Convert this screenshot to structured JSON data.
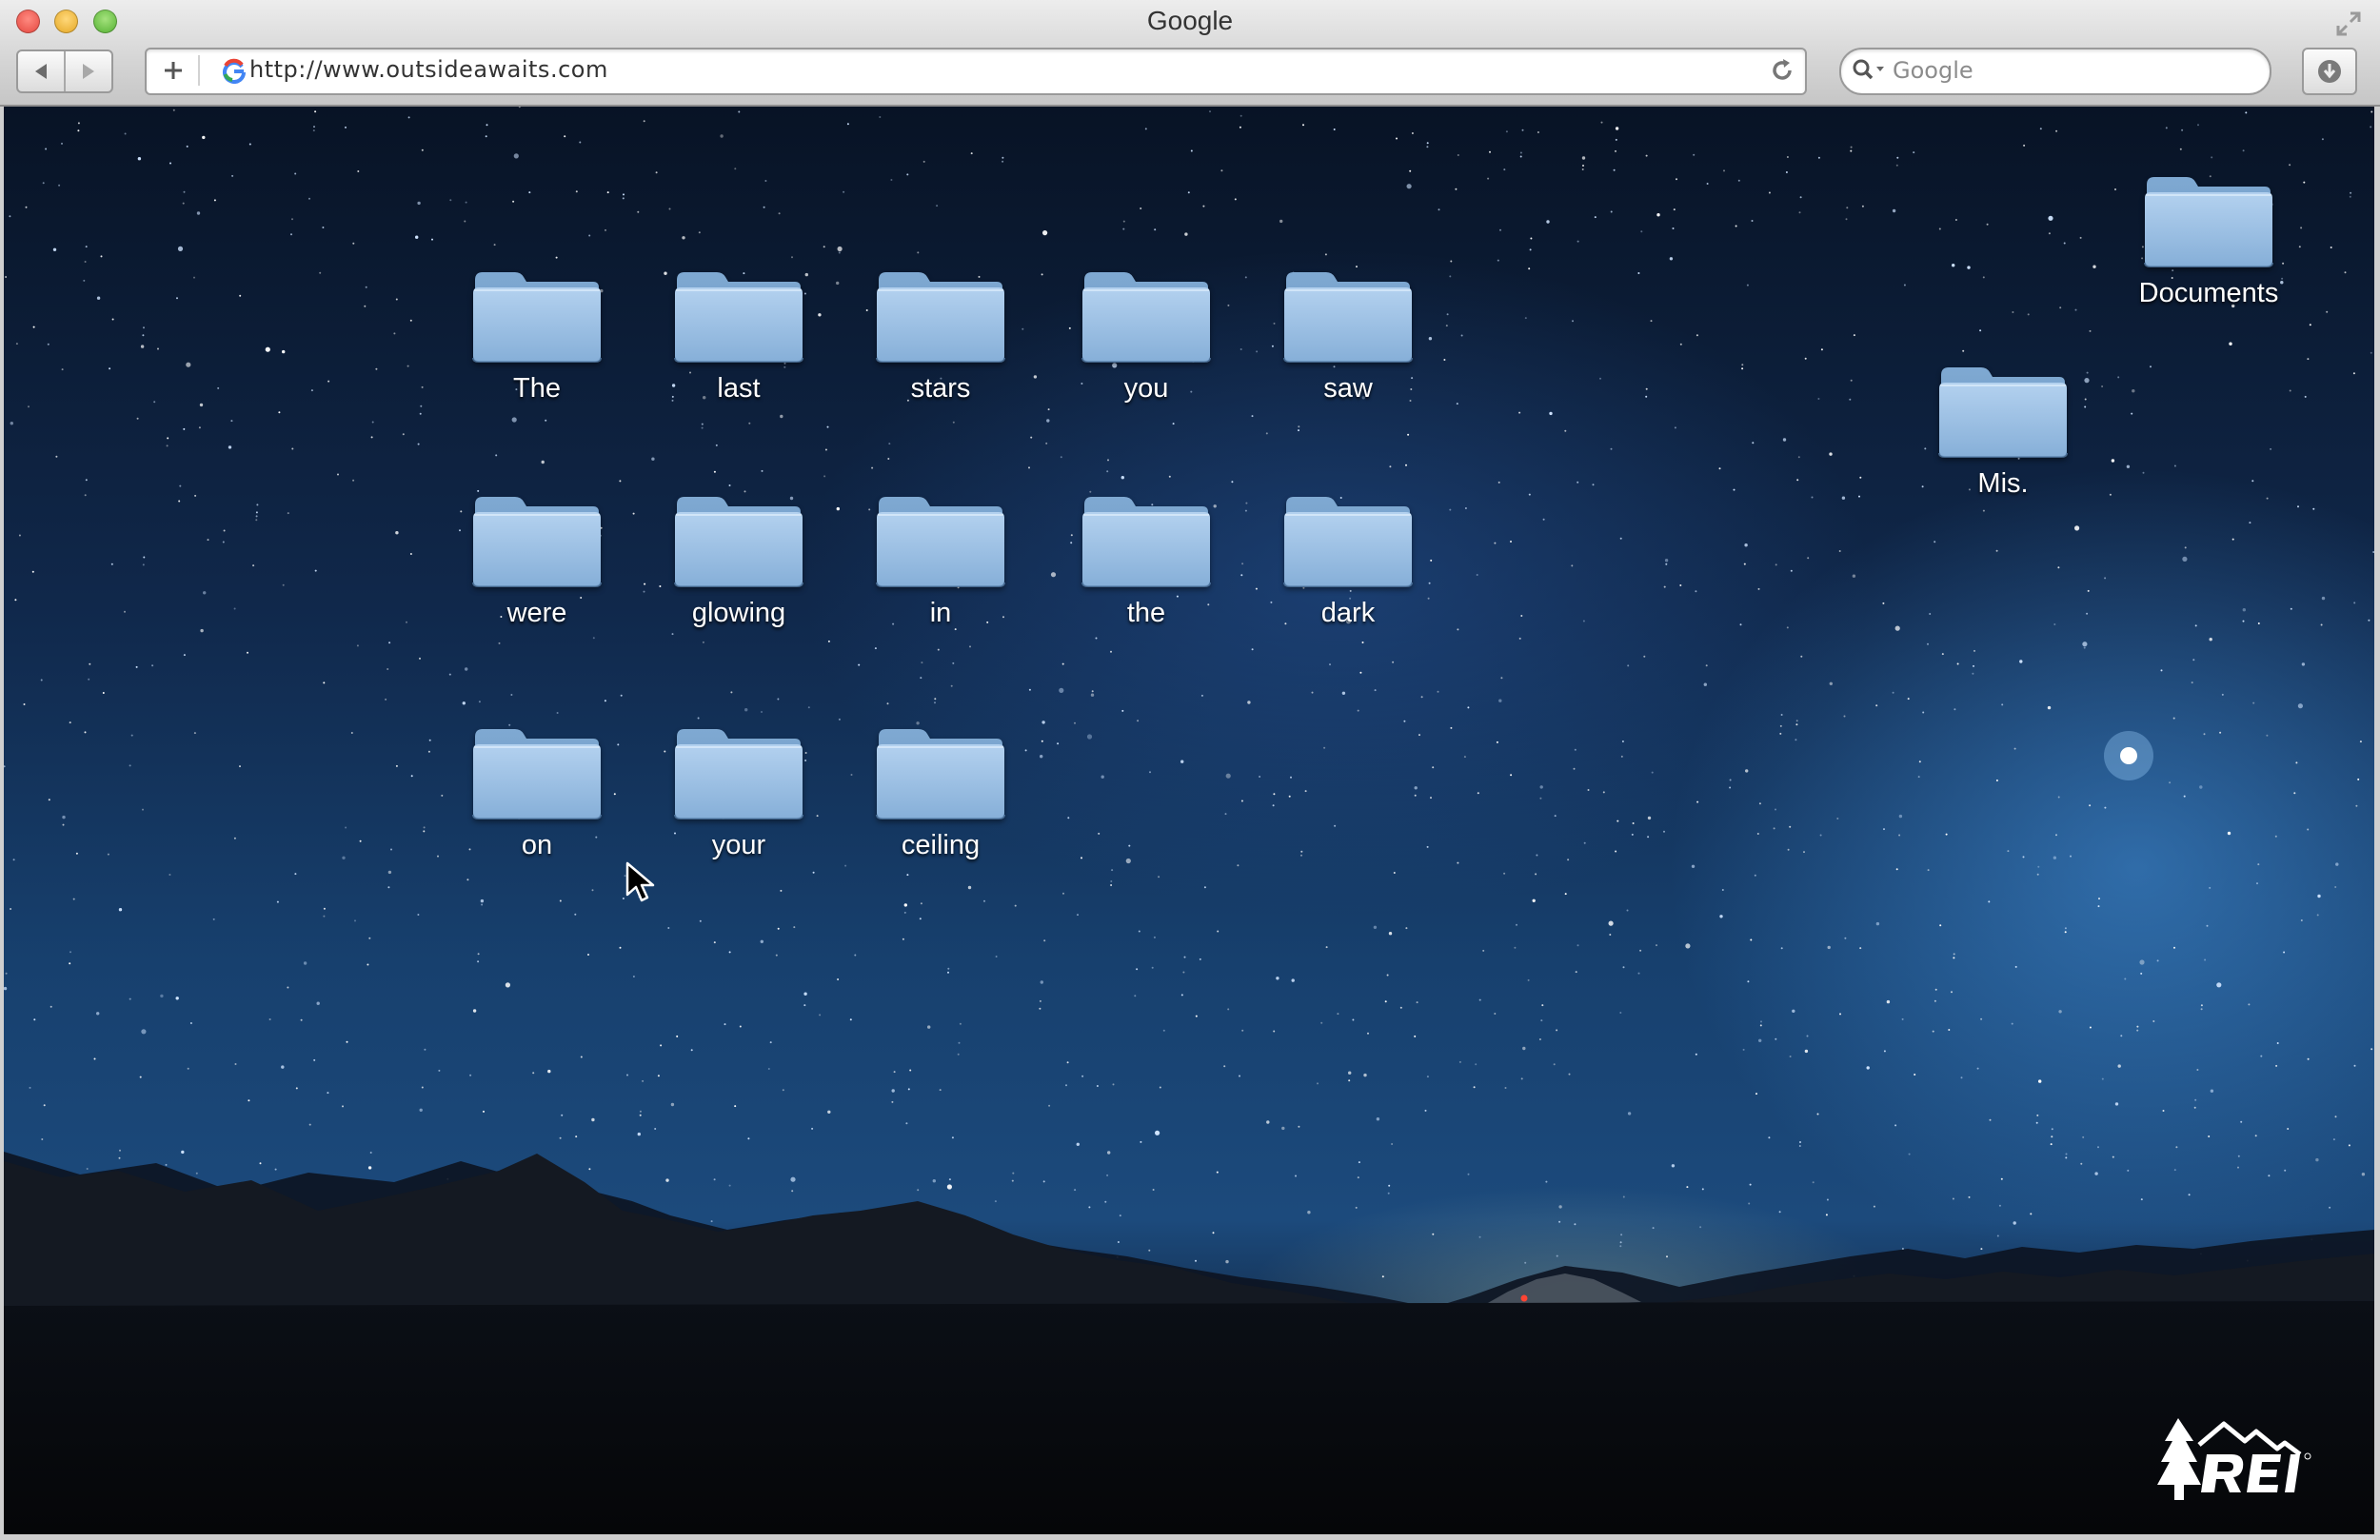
{
  "window": {
    "title": "Google"
  },
  "toolbar": {
    "url": "http://www.outsideawaits.com",
    "search_placeholder": "Google",
    "icons": [
      "back-arrow-icon",
      "forward-arrow-icon",
      "plus-icon",
      "google-favicon-icon",
      "reload-icon",
      "search-icon",
      "download-icon",
      "fullscreen-icon"
    ]
  },
  "desktop": {
    "folders": [
      {
        "label": "The"
      },
      {
        "label": "last"
      },
      {
        "label": "stars"
      },
      {
        "label": "you"
      },
      {
        "label": "saw"
      },
      {
        "label": "were"
      },
      {
        "label": "glowing"
      },
      {
        "label": "in"
      },
      {
        "label": "the"
      },
      {
        "label": "dark"
      },
      {
        "label": "on"
      },
      {
        "label": "your"
      },
      {
        "label": "ceiling"
      }
    ],
    "side_folders": [
      {
        "label": "Documents"
      },
      {
        "label": "Mis."
      }
    ],
    "folder_color": "#8fb6dc",
    "logo": "REI"
  }
}
